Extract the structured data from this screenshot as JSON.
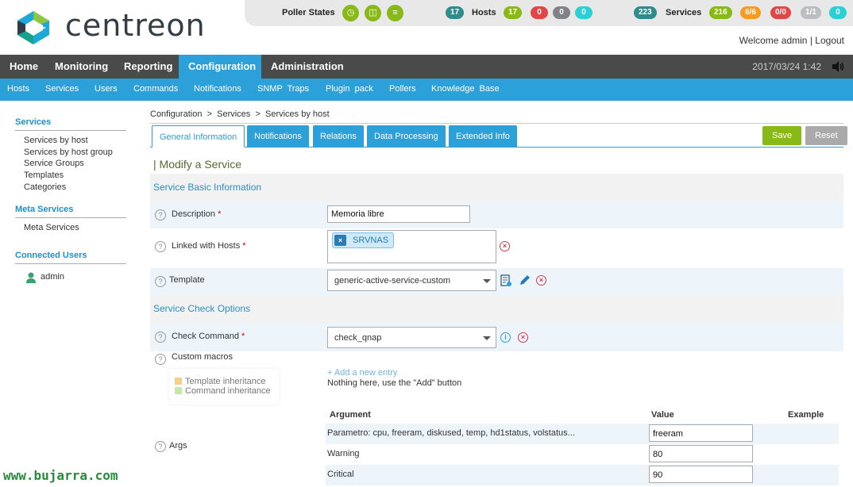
{
  "brand": {
    "name": "centreon"
  },
  "status": {
    "poller_label": "Poller States",
    "poller_icons": [
      "clock-icon",
      "database-icon",
      "stack-icon"
    ],
    "hosts_label": "Hosts",
    "hosts_total": "17",
    "hosts_up": "17",
    "hosts_down": "0",
    "hosts_unreachable": "0",
    "hosts_pending": "0",
    "services_label": "Services",
    "services_total": "223",
    "services_ok": "216",
    "services_warning": "6/6",
    "services_critical": "0/0",
    "services_unknown": "1/1",
    "services_pending": "0",
    "colors": {
      "ok": "#88b917",
      "total": "#2e8c8c",
      "warning": "#f59b23",
      "critical": "#e04646",
      "unknown": "#bcbdc0",
      "unreachable": "#818285",
      "pending": "#2ad1d4"
    }
  },
  "user": {
    "welcome": "Welcome admin",
    "logout": "Logout"
  },
  "nav": {
    "main": [
      "Home",
      "Monitoring",
      "Reporting",
      "Configuration",
      "Administration"
    ],
    "active": "Configuration",
    "datetime": "2017/03/24 1:42",
    "sub": [
      "Hosts",
      "Services",
      "Users",
      "Commands",
      "Notifications",
      "SNMP Traps",
      "Plugin pack",
      "Pollers",
      "Knowledge Base"
    ]
  },
  "sidebar": {
    "services_head": "Services",
    "services_items": [
      "Services by host",
      "Services by host group",
      "Service Groups",
      "Templates",
      "Categories"
    ],
    "meta_head": "Meta Services",
    "meta_items": [
      "Meta Services"
    ],
    "users_head": "Connected Users",
    "users": [
      "admin"
    ]
  },
  "breadcrumb": {
    "c1": "Configuration",
    "c2": "Services",
    "c3": "Services by host",
    "sep": ">"
  },
  "tabs": [
    "General Information",
    "Notifications",
    "Relations",
    "Data Processing",
    "Extended Info"
  ],
  "actions": {
    "save": "Save",
    "reset": "Reset"
  },
  "form": {
    "title": "| Modify a Service",
    "basic_head": "Service Basic Information",
    "description_label": "Description",
    "description_value": "Memoria libre",
    "hosts_label": "Linked with Hosts",
    "hosts_chip": "SRVNAS",
    "template_label": "Template",
    "template_value": "generic-active-service-custom",
    "check_head": "Service Check Options",
    "command_label": "Check Command",
    "command_value": "check_qnap",
    "macros_label": "Custom macros",
    "macro_legend_template": "Template inheritance",
    "macro_legend_command": "Command inheritance",
    "add_entry": "+ Add a new entry",
    "nothing_here": "Nothing here, use the \"Add\" button",
    "args_label": "Args",
    "args_headers": {
      "argument": "Argument",
      "value": "Value",
      "example": "Example"
    },
    "args": [
      {
        "argument": "Parametro: cpu, freeram, diskused, temp, hd1status, volstatus...",
        "value": "freeram"
      },
      {
        "argument": "Warning",
        "value": "80"
      },
      {
        "argument": "Critical",
        "value": "90"
      }
    ]
  },
  "watermark": "www.bujarra.com"
}
